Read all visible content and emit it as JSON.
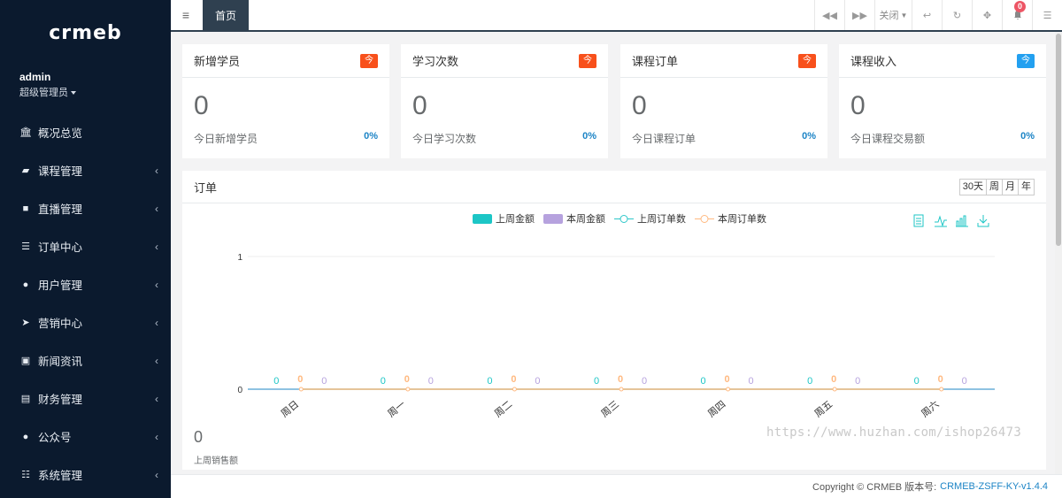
{
  "sidebar": {
    "logo": "crmeb",
    "user": {
      "name": "admin",
      "role": "超级管理员"
    },
    "items": [
      {
        "label": "概况总览",
        "icon": "bank-icon",
        "has_arrow": false
      },
      {
        "label": "课程管理",
        "icon": "book-icon",
        "has_arrow": true
      },
      {
        "label": "直播管理",
        "icon": "video-icon",
        "has_arrow": true
      },
      {
        "label": "订单中心",
        "icon": "list-icon",
        "has_arrow": true
      },
      {
        "label": "用户管理",
        "icon": "user-icon",
        "has_arrow": true
      },
      {
        "label": "营销中心",
        "icon": "send-icon",
        "has_arrow": true
      },
      {
        "label": "新闻资讯",
        "icon": "image-icon",
        "has_arrow": true
      },
      {
        "label": "财务管理",
        "icon": "money-icon",
        "has_arrow": true
      },
      {
        "label": "公众号",
        "icon": "wechat-icon",
        "has_arrow": true
      },
      {
        "label": "系统管理",
        "icon": "grid-icon",
        "has_arrow": true
      }
    ]
  },
  "topbar": {
    "tab": "首页",
    "close_label": "关闭",
    "notification_count": "0"
  },
  "cards": [
    {
      "title": "新增学员",
      "tag": "今",
      "tag_color": "#f8501b",
      "value": "0",
      "sub": "今日新增学员",
      "percent": "0%"
    },
    {
      "title": "学习次数",
      "tag": "今",
      "tag_color": "#f8501b",
      "value": "0",
      "sub": "今日学习次数",
      "percent": "0%"
    },
    {
      "title": "课程订单",
      "tag": "今",
      "tag_color": "#f8501b",
      "value": "0",
      "sub": "今日课程订单",
      "percent": "0%"
    },
    {
      "title": "课程收入",
      "tag": "今",
      "tag_color": "#23a0f0",
      "value": "0",
      "sub": "今日课程交易额",
      "percent": "0%"
    }
  ],
  "orders_panel": {
    "title": "订单",
    "periods": [
      "30天",
      "周",
      "月",
      "年"
    ],
    "last_week_sales_value": "0",
    "last_week_sales_label": "上周销售额"
  },
  "chart_data": {
    "type": "bar",
    "categories": [
      "周日",
      "周一",
      "周二",
      "周三",
      "周四",
      "周五",
      "周六"
    ],
    "series": [
      {
        "name": "上周金额",
        "kind": "bar",
        "color": "#1cc6c6",
        "values": [
          0,
          0,
          0,
          0,
          0,
          0,
          0
        ]
      },
      {
        "name": "本周金额",
        "kind": "bar",
        "color": "#b6a2de",
        "values": [
          0,
          0,
          0,
          0,
          0,
          0,
          0
        ]
      },
      {
        "name": "上周订单数",
        "kind": "line",
        "color": "#2ec7c9",
        "values": [
          0,
          0,
          0,
          0,
          0,
          0,
          0
        ]
      },
      {
        "name": "本周订单数",
        "kind": "line",
        "color": "#ffb980",
        "values": [
          0,
          0,
          0,
          0,
          0,
          0,
          0
        ]
      }
    ],
    "ylim": [
      0,
      1
    ],
    "yticks": [
      "0",
      "1"
    ],
    "legend": "top-center",
    "grid": true,
    "toolbox": [
      "data-view-icon",
      "line-chart-icon",
      "bar-chart-icon",
      "download-icon"
    ]
  },
  "footer": {
    "copyright": "Copyright © CRMEB 版本号:",
    "version": "CRMEB-ZSFF-KY-v1.4.4"
  },
  "watermark": "https://www.huzhan.com/ishop26473"
}
